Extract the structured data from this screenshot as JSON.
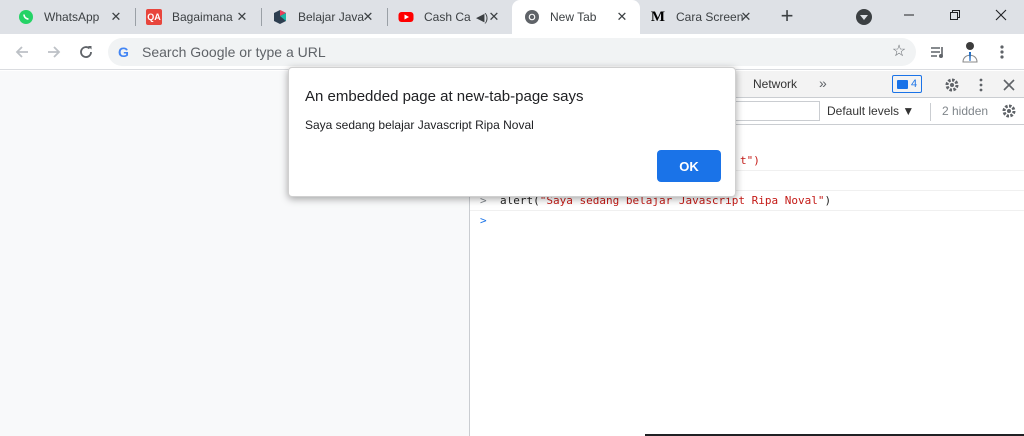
{
  "tabs": [
    {
      "title": "WhatsApp",
      "icon": "whatsapp-icon",
      "active": false
    },
    {
      "title": "Bagaimana",
      "icon": "qa-icon",
      "icon_text": "QA",
      "active": false
    },
    {
      "title": "Belajar Java",
      "icon": "dicoding-icon",
      "active": false
    },
    {
      "title": "Cash Ca",
      "icon": "youtube-icon",
      "audio": true,
      "active": false
    },
    {
      "title": "New Tab",
      "icon": "chrome-icon",
      "active": true
    },
    {
      "title": "Cara Screen",
      "icon": "medium-icon",
      "icon_text": "M",
      "active": false
    }
  ],
  "omnibox": {
    "placeholder": "Search Google or type a URL",
    "g_letter": "G"
  },
  "devtools": {
    "tab_network": "Network",
    "issues_count": "4",
    "levels": "Default levels ▼",
    "hidden": "2 hidden",
    "console": {
      "line1_tail": "t\")",
      "line2_prompt": ">",
      "line2_code_prefix": "alert(",
      "line2_string": "\"Saya sedang belajar Javascript Ripa Noval\"",
      "line2_code_suffix": ")",
      "line3_prompt": ">"
    }
  },
  "dialog": {
    "title": "An embedded page at new-tab-page says",
    "message": "Saya sedang belajar Javascript Ripa Noval",
    "ok_label": "OK"
  },
  "colors": {
    "accent": "#1a73e8",
    "tabstrip": "#dee1e6",
    "string": "#c41a16"
  }
}
